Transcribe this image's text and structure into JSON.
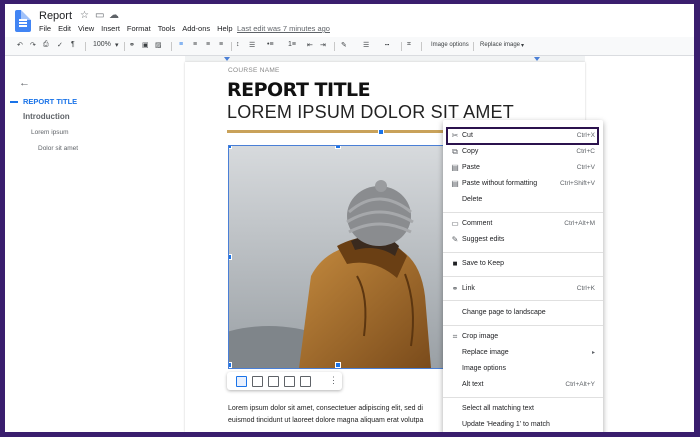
{
  "header": {
    "doc_title": "Report",
    "star_icon": "star-icon",
    "move_icon": "folder-icon",
    "cloud_icon": "cloud-icon",
    "menu": [
      "File",
      "Edit",
      "View",
      "Insert",
      "Format",
      "Tools",
      "Add-ons",
      "Help"
    ],
    "last_edit": "Last edit was 7 minutes ago"
  },
  "toolbar": {
    "zoom": "100%",
    "image_options": "Image options",
    "replace_image": "Replace image"
  },
  "outline": {
    "heading": "REPORT TITLE",
    "introduction": "Introduction",
    "sub1": "Lorem ipsum",
    "sub2": "Dolor sit amet"
  },
  "document": {
    "course_name": "COURSE NAME",
    "report_title": "REPORT TITLE",
    "subtitle": "LOREM IPSUM DOLOR SIT AMET",
    "paragraph_line1": "Lorem ipsum dolor sit amet, consectetuer adipiscing elit, sed di",
    "paragraph_line2": "euismod tincidunt ut laoreet dolore magna aliquam erat volutpa"
  },
  "context_menu": {
    "cut": {
      "label": "Cut",
      "shortcut": "Ctrl+X"
    },
    "copy": {
      "label": "Copy",
      "shortcut": "Ctrl+C"
    },
    "paste": {
      "label": "Paste",
      "shortcut": "Ctrl+V"
    },
    "paste_plain": {
      "label": "Paste without formatting",
      "shortcut": "Ctrl+Shift+V"
    },
    "delete": {
      "label": "Delete"
    },
    "comment": {
      "label": "Comment",
      "shortcut": "Ctrl+Alt+M"
    },
    "suggest_edits": {
      "label": "Suggest edits"
    },
    "save_to_keep": {
      "label": "Save to Keep"
    },
    "link": {
      "label": "Link",
      "shortcut": "Ctrl+K"
    },
    "change_page": {
      "label": "Change page to landscape"
    },
    "crop_image": {
      "label": "Crop image"
    },
    "replace_image": {
      "label": "Replace image"
    },
    "image_options": {
      "label": "Image options"
    },
    "alt_text": {
      "label": "Alt text",
      "shortcut": "Ctrl+Alt+Y"
    },
    "select_matching": {
      "label": "Select all matching text"
    },
    "update_heading": {
      "label": "Update 'Heading 1' to match"
    }
  }
}
